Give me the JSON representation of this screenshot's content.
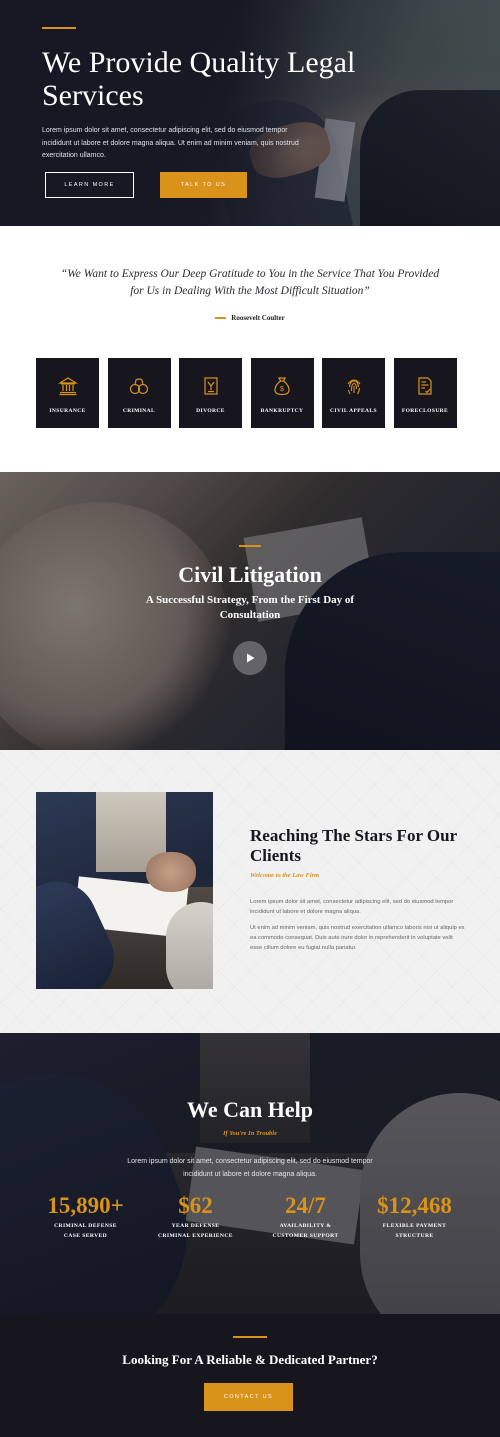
{
  "colors": {
    "accent": "#d9931a",
    "dark": "#17161f",
    "light_bg": "#f1f1f1"
  },
  "hero": {
    "title": "We Provide Quality Legal Services",
    "text": "Lorem ipsum dolor sit amet, consectetur adipiscing elit, sed do eiusmod tempor incididunt ut labore et dolore magna aliqua. Ut enim ad minim veniam, quis nostrud exercitation ullamco.",
    "learn_more": "LEARN MORE",
    "talk_to_us": "TALK TO US"
  },
  "testimonial": {
    "quote": "“We Want to Express Our Deep Gratitude to You in the Service That You Provided for Us in Dealing With the Most Difficult Situation”",
    "author": "Roosevelt Coulter"
  },
  "services": [
    {
      "label": "INSURANCE",
      "icon": "bank-icon"
    },
    {
      "label": "CRIMINAL",
      "icon": "handcuffs-icon"
    },
    {
      "label": "DIVORCE",
      "icon": "document-icon"
    },
    {
      "label": "BANKRUPTCY",
      "icon": "money-bag-icon"
    },
    {
      "label": "CIVIL APPEALS",
      "icon": "fingerprint-icon"
    },
    {
      "label": "FORECLOSURE",
      "icon": "contract-icon"
    }
  ],
  "civil": {
    "title": "Civil Litigation",
    "subtitle": "A Successful Strategy, From the First Day of Consultation"
  },
  "about": {
    "title": "Reaching The Stars For Our Clients",
    "kicker": "Welcome to the Law Firm",
    "p1": "Lorem ipsum dolor sit amet, consectetur adipiscing elit, sed do eiusmod tempor incididunt ut labore et dolore magna aliqua.",
    "p2": "Ut enim ad minim veniam, quis nostrud exercitation ullamco laboris nisi ut aliquip ex ea commodo consequat. Duis aute irure dolor in reprehenderit in voluptate velit esse cillum dolore eu fugiat nulla pariatur."
  },
  "help": {
    "title": "We Can Help",
    "kicker": "If You're In Trouble",
    "text": "Lorem ipsum dolor sit amet, consectetur adipiscing elit, sed do eiusmod tempor incididunt ut labore et dolore magna aliqua.",
    "stats": [
      {
        "value": "15,890+",
        "label": "CRIMINAL DEFENSE\nCASE SERVED"
      },
      {
        "value": "$62",
        "label": "YEAR DEFENSE\nCRIMINAL EXPERIENCE"
      },
      {
        "value": "24/7",
        "label": "AVAILABILITY &\nCUSTOMER SUPPORT"
      },
      {
        "value": "$12,468",
        "label": "FLEXIBLE PAYMENT\nSTRUCTURE"
      }
    ]
  },
  "cta": {
    "title": "Looking For A Reliable & Dedicated Partner?",
    "button": "CONTACT US"
  }
}
